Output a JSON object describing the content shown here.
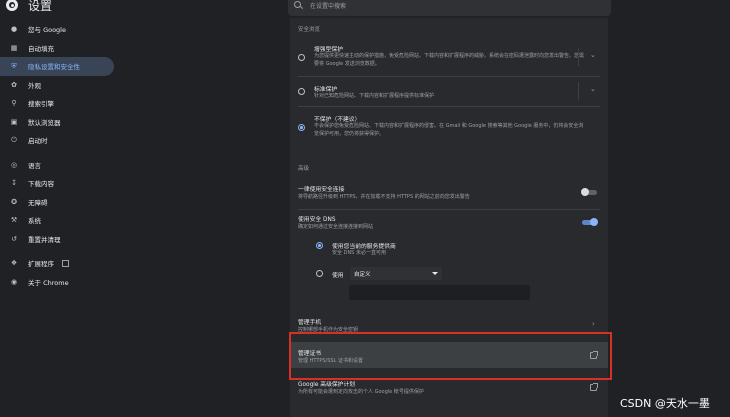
{
  "header": {
    "title": "设置",
    "search_placeholder": "在设置中搜索"
  },
  "sidebar": {
    "items": [
      {
        "label": "您与 Google",
        "icon": "person-icon"
      },
      {
        "label": "自动填充",
        "icon": "clipboard-icon"
      },
      {
        "label": "隐私设置和安全性",
        "icon": "shield-icon",
        "active": true
      },
      {
        "label": "外观",
        "icon": "palette-icon"
      },
      {
        "label": "搜索引擎",
        "icon": "search-icon"
      },
      {
        "label": "默认浏览器",
        "icon": "browser-icon"
      },
      {
        "label": "启动时",
        "icon": "power-icon"
      },
      {
        "label": "语言",
        "icon": "globe-icon"
      },
      {
        "label": "下载内容",
        "icon": "download-icon"
      },
      {
        "label": "无障碍",
        "icon": "accessibility-icon"
      },
      {
        "label": "系统",
        "icon": "wrench-icon"
      },
      {
        "label": "重置并清理",
        "icon": "history-icon"
      },
      {
        "label": "扩展程序",
        "icon": "puzzle-icon"
      },
      {
        "label": "关于 Chrome",
        "icon": "chrome-icon"
      }
    ]
  },
  "main": {
    "safe_browsing_label": "安全浏览",
    "options": [
      {
        "title": "增强型保护",
        "subtitle": "为您提供更快速主动的保护措施，免受危险网站、下载内容和扩展程序的威胁。系统会在密码遭泄露时向您发出警告。您需要将 Google 发送浏览数据。",
        "checked": false
      },
      {
        "title": "标准保护",
        "subtitle": "针对已知危险网站、下载内容和扩展程序提供标准保护",
        "checked": false
      },
      {
        "title": "不保护（不建议）",
        "subtitle": "不会保护您免受危险网站、下载内容和扩展程序的侵害。在 Gmail 和 Google 搜索等其他 Google 服务中，仍将会安全浏览保护可用，您仍将获得保护。",
        "checked": true
      }
    ],
    "advanced_label": "高级",
    "https_title": "一律使用安全连接",
    "https_sub": "将导航路径升级到 HTTPS，并在加载不支持 HTTPS 的网站之前向您发出警告",
    "https_on": false,
    "dns_title": "使用安全 DNS",
    "dns_sub": "确定如何通过安全连接连接到网站",
    "dns_on": true,
    "dns_option1_title": "使用您当前的服务提供商",
    "dns_option1_sub": "安全 DNS 未必一直可用",
    "dns_option2_label": "使用",
    "dns_dropdown_value": "自定义",
    "phone_title": "管理手机",
    "phone_sub": "控制哪部手机作为安全密钥",
    "cert_title": "管理证书",
    "cert_sub": "管理 HTTPS/SSL 证书和设置",
    "adv_title": "Google 高级保护计划",
    "adv_sub": "为所有可能会遭到定向攻击的个人 Google 帐号提供保护"
  },
  "watermark": "CSDN @天水一墨",
  "colors": {
    "background": "#202124",
    "panel": "#292a2d",
    "accent": "#8ab4f8",
    "highlight": "#d93025"
  }
}
